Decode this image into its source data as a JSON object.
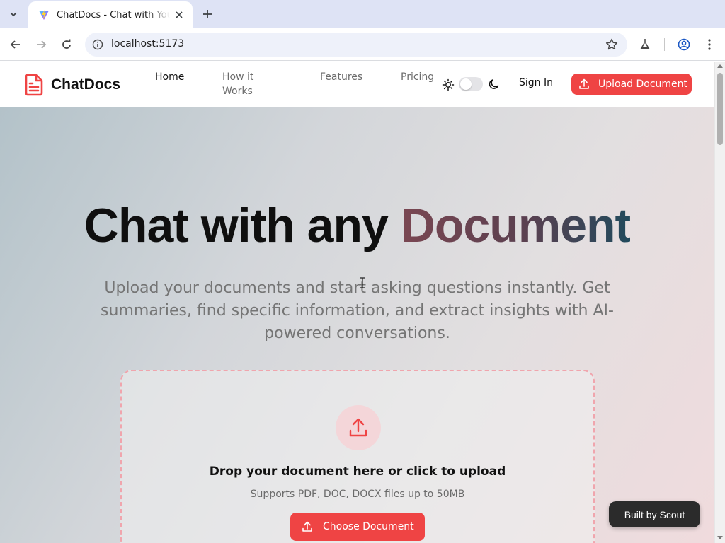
{
  "browser": {
    "tab_title": "ChatDocs - Chat with Your Documents",
    "url": "localhost:5173"
  },
  "header": {
    "logo_text": "ChatDocs",
    "nav": [
      {
        "label": "Home",
        "active": true
      },
      {
        "label": "How it Works",
        "active": false
      },
      {
        "label": "Features",
        "active": false
      },
      {
        "label": "Pricing",
        "active": false
      }
    ],
    "sign_in_label": "Sign In",
    "upload_button_label": "Upload Document"
  },
  "hero": {
    "title_main": "Chat with any ",
    "title_accent": "Document",
    "subtitle": "Upload your documents and start asking questions instantly. Get summaries, find specific information, and extract insights with AI-powered conversations."
  },
  "dropzone": {
    "title": "Drop your document here or click to upload",
    "subtitle": "Supports PDF, DOC, DOCX files up to 50MB",
    "button_label": "Choose Document"
  },
  "badge": {
    "label": "Built by Scout"
  },
  "colors": {
    "brand": "#ef4444",
    "accent_gradient_start": "#7a4752",
    "accent_gradient_end": "#214a5c"
  }
}
